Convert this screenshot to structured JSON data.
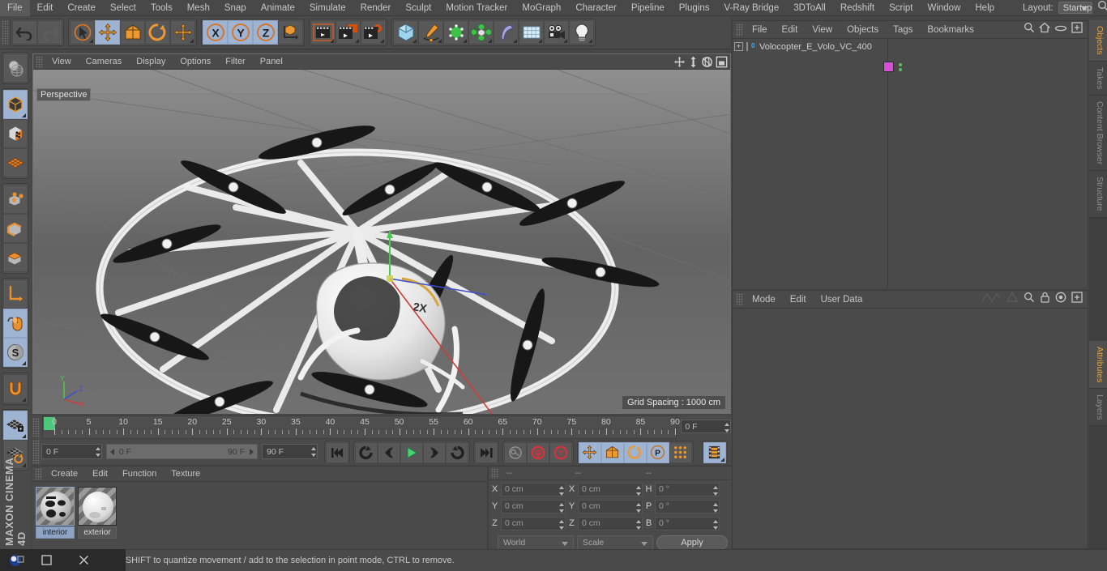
{
  "app": {
    "title": "MAXON CINEMA 4D",
    "brand": "MAXON CINEMA 4D",
    "accent": "#e8a33d",
    "panel_bg": "#4a4a4a",
    "highlight_blue": "#9fb4d2"
  },
  "menubar": {
    "items": [
      "File",
      "Edit",
      "Create",
      "Select",
      "Tools",
      "Mesh",
      "Snap",
      "Animate",
      "Simulate",
      "Render",
      "Sculpt",
      "Motion Tracker",
      "MoGraph",
      "Character",
      "Pipeline",
      "Plugins",
      "V-Ray Bridge",
      "3DToAll",
      "Redshift",
      "Script",
      "Window",
      "Help"
    ],
    "layout_label": "Layout:",
    "layout_value": "Startup",
    "search_icon": "search-icon"
  },
  "toolbar": {
    "groups": [
      {
        "name": "history",
        "buttons": [
          {
            "name": "undo-button",
            "icon": "undo-icon",
            "active": false
          },
          {
            "name": "redo-button",
            "icon": "redo-icon",
            "active": false,
            "disabled": true
          }
        ]
      },
      {
        "name": "transform-tools",
        "buttons": [
          {
            "name": "live-selection-tool",
            "icon": "cursor-circle-icon",
            "active": false
          },
          {
            "name": "move-tool",
            "icon": "move-arrows-icon",
            "active": true
          },
          {
            "name": "scale-tool",
            "icon": "scale-box-icon",
            "active": false
          },
          {
            "name": "rotate-tool",
            "icon": "rotate-circle-icon",
            "active": false
          },
          {
            "name": "global-move-tool",
            "icon": "move-arrows-icon",
            "active": false
          }
        ]
      },
      {
        "name": "axis-locks",
        "buttons": [
          {
            "name": "lock-x-axis-button",
            "icon": "x-axis-icon",
            "active": true
          },
          {
            "name": "lock-y-axis-button",
            "icon": "y-axis-icon",
            "active": true
          },
          {
            "name": "lock-z-axis-button",
            "icon": "z-axis-icon",
            "active": true
          },
          {
            "name": "world-object-coordinates-button",
            "icon": "world-axis-cube-icon",
            "active": false
          }
        ]
      },
      {
        "name": "render-tools",
        "buttons": [
          {
            "name": "render-view-button",
            "icon": "clapper-view-icon",
            "active": false
          },
          {
            "name": "render-to-picture-viewer-button",
            "icon": "clapper-picture-icon",
            "active": false
          },
          {
            "name": "edit-render-settings-button",
            "icon": "clapper-gear-icon",
            "active": false
          }
        ]
      },
      {
        "name": "create-tools",
        "buttons": [
          {
            "name": "add-cube-button",
            "icon": "cube-icon",
            "active": false
          },
          {
            "name": "add-spline-button",
            "icon": "pen-spline-icon",
            "active": false
          },
          {
            "name": "add-nurbs-button",
            "icon": "green-cube-nurbs-icon",
            "active": false
          },
          {
            "name": "add-array-button",
            "icon": "array-cluster-icon",
            "active": false
          },
          {
            "name": "add-bend-deformer-button",
            "icon": "bend-deformer-icon",
            "active": false
          },
          {
            "name": "add-floor-button",
            "icon": "floor-grid-icon",
            "active": false
          },
          {
            "name": "add-camera-button",
            "icon": "camera-icon",
            "active": false
          },
          {
            "name": "add-light-button",
            "icon": "light-bulb-icon",
            "active": false
          }
        ]
      }
    ]
  },
  "left_toolbar": {
    "groups": [
      {
        "name": "render-region",
        "buttons": [
          {
            "name": "make-editable-button",
            "icon": "globe-sphere-icon",
            "active": false
          }
        ]
      },
      {
        "name": "mode-tools",
        "buttons": [
          {
            "name": "model-mode-button",
            "icon": "model-cube-icon",
            "active": true
          },
          {
            "name": "texture-mode-button",
            "icon": "texture-checker-cube-icon",
            "active": false
          },
          {
            "name": "deformer-mode-button",
            "icon": "deformer-grid-icon",
            "active": false
          }
        ]
      },
      {
        "name": "component-modes",
        "buttons": [
          {
            "name": "points-mode-button",
            "icon": "points-cube-icon",
            "active": false
          },
          {
            "name": "edges-mode-button",
            "icon": "edges-cube-icon",
            "active": false
          },
          {
            "name": "polygons-mode-button",
            "icon": "polygons-cube-icon",
            "active": false
          }
        ]
      },
      {
        "name": "axis-modes",
        "buttons": [
          {
            "name": "enable-axis-modification-button",
            "icon": "axis-arrow-icon",
            "active": false
          },
          {
            "name": "viewport-solo-button",
            "icon": "mouse-spline-icon",
            "active": true
          },
          {
            "name": "snap-settings-button",
            "icon": "snap-s-icon",
            "active": true
          }
        ]
      },
      {
        "name": "magnet",
        "buttons": [
          {
            "name": "magnet-tool-button",
            "icon": "magnet-icon",
            "active": false
          }
        ]
      },
      {
        "name": "workplane",
        "buttons": [
          {
            "name": "lock-workplane-button",
            "icon": "workplane-lock-icon",
            "active": true
          },
          {
            "name": "workplane-rotate-button",
            "icon": "workplane-rotate-icon",
            "active": false
          }
        ]
      }
    ]
  },
  "viewport": {
    "menu": [
      "View",
      "Cameras",
      "Display",
      "Options",
      "Filter",
      "Panel"
    ],
    "label": "Perspective",
    "grid_spacing": "Grid Spacing : 1000 cm",
    "nav_icons": [
      "pan-icon",
      "dolly-icon",
      "orbit-icon",
      "maximize-viewport-icon"
    ],
    "axis_labels": {
      "x": "X",
      "y": "Y",
      "z": "Z"
    },
    "scene": "Volocopter multirotor aircraft 3D model"
  },
  "timeline": {
    "ticks": [
      0,
      5,
      10,
      15,
      20,
      25,
      30,
      35,
      40,
      45,
      50,
      55,
      60,
      65,
      70,
      75,
      80,
      85,
      90
    ],
    "min_frame": 0,
    "max_frame": 90,
    "current_frame_display": "0 F",
    "playhead_frame": 0
  },
  "animbar": {
    "current_frame": "0 F",
    "range_start": "0 F",
    "range_end": "90 F",
    "end_frame": "90 F",
    "transport": [
      {
        "name": "go-to-start-button",
        "icon": "skip-start-icon"
      },
      {
        "name": "play-backwards-button",
        "icon": "rewind-loop-icon"
      },
      {
        "name": "previous-frame-button",
        "icon": "step-back-icon"
      },
      {
        "name": "play-forwards-button",
        "icon": "play-icon"
      },
      {
        "name": "next-frame-button",
        "icon": "step-forward-icon"
      },
      {
        "name": "play-forward-loop-button",
        "icon": "forward-loop-icon"
      },
      {
        "name": "go-to-end-button",
        "icon": "skip-end-icon"
      }
    ],
    "keys": [
      {
        "name": "record-active-objects-button",
        "icon": "key-grey-icon"
      },
      {
        "name": "autokeying-button",
        "icon": "autokey-red-icon"
      },
      {
        "name": "keyframe-selection-button",
        "icon": "question-red-icon"
      }
    ],
    "key_toggles": [
      {
        "name": "position-key-button",
        "icon": "move-arrows-icon",
        "active": true
      },
      {
        "name": "scale-key-button",
        "icon": "scale-box-icon",
        "active": true
      },
      {
        "name": "rotation-key-button",
        "icon": "rotate-circle-icon",
        "active": true
      },
      {
        "name": "parameter-key-button",
        "icon": "parameter-p-icon",
        "active": true
      },
      {
        "name": "point-level-animation-button",
        "icon": "pla-dots-icon",
        "active": false
      }
    ],
    "timeline_toggle": {
      "name": "key-mode-button",
      "icon": "film-strip-icon",
      "active": true
    }
  },
  "material_manager": {
    "menu": [
      "Create",
      "Edit",
      "Function",
      "Texture"
    ],
    "materials": [
      {
        "name": "interior",
        "selected": true,
        "color": "#cfcfcf"
      },
      {
        "name": "exterior",
        "selected": false,
        "color": "#e8e8e8"
      }
    ]
  },
  "coordinate_manager": {
    "header": [
      "--",
      "--",
      "--"
    ],
    "rows": [
      {
        "pos_label": "X",
        "pos_value": "0 cm",
        "size_label": "X",
        "size_value": "0 cm",
        "rot_label": "H",
        "rot_value": "0 °"
      },
      {
        "pos_label": "Y",
        "pos_value": "0 cm",
        "size_label": "Y",
        "size_value": "0 cm",
        "rot_label": "P",
        "rot_value": "0 °"
      },
      {
        "pos_label": "Z",
        "pos_value": "0 cm",
        "size_label": "Z",
        "size_value": "0 cm",
        "rot_label": "B",
        "rot_value": "0 °"
      }
    ],
    "coord_system": "World",
    "transform_mode": "Scale",
    "apply_label": "Apply"
  },
  "object_manager": {
    "menu": [
      "File",
      "Edit",
      "View",
      "Objects",
      "Tags",
      "Bookmarks"
    ],
    "icons": [
      "search-icon",
      "home-icon",
      "ellipse-icon",
      "new-layer-icon"
    ],
    "objects": [
      {
        "name": "Volocopter_E_Volo_VC_400",
        "level": 0,
        "expandable": true,
        "tag_color": "#d64fd6"
      }
    ]
  },
  "attribute_manager": {
    "menu": [
      "Mode",
      "Edit",
      "User Data"
    ],
    "icons": [
      "interpolation-icon",
      "cone-icon",
      "search-icon",
      "lock-icon",
      "target-icon",
      "new-tab-icon"
    ],
    "content": ""
  },
  "right_tabs": [
    {
      "label": "Objects",
      "active": true
    },
    {
      "label": "Takes",
      "active": false
    },
    {
      "label": "Content Browser",
      "active": false
    },
    {
      "label": "Structure",
      "active": false
    },
    {
      "label": "Attributes",
      "active": true
    },
    {
      "label": "Layers",
      "active": false
    }
  ],
  "statusbar": {
    "text": "Move elements. Hold down SHIFT to quantize movement / add to the selection in point mode, CTRL to remove."
  },
  "taskbar": {
    "buttons": [
      {
        "name": "restore-window-button",
        "icon": "restore-icon"
      },
      {
        "name": "maximize-window-button",
        "icon": "maximize-icon"
      },
      {
        "name": "close-window-button",
        "icon": "close-icon"
      }
    ],
    "logo": "cinema4d-logo-icon"
  }
}
